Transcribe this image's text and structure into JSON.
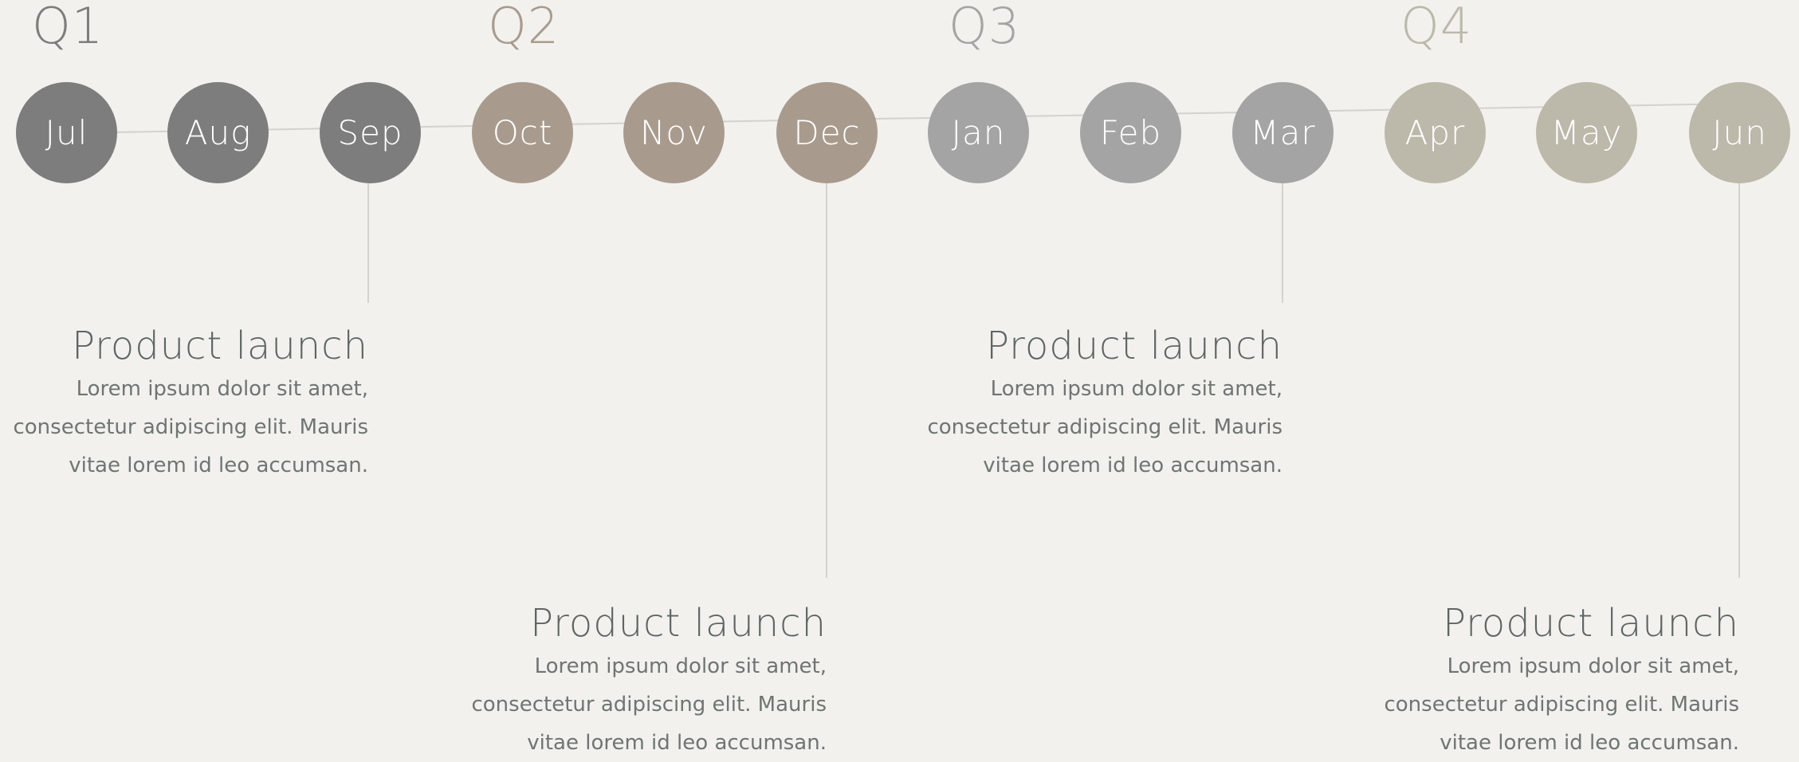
{
  "quarters": [
    {
      "label": "Q1",
      "color": "#7d7d7d"
    },
    {
      "label": "Q2",
      "color": "#a89b8e"
    },
    {
      "label": "Q3",
      "color": "#a4a4a4"
    },
    {
      "label": "Q4",
      "color": "#bcb8aa"
    }
  ],
  "months": [
    {
      "label": "Jul",
      "quarter": 0
    },
    {
      "label": "Aug",
      "quarter": 0
    },
    {
      "label": "Sep",
      "quarter": 0
    },
    {
      "label": "Oct",
      "quarter": 1
    },
    {
      "label": "Nov",
      "quarter": 1
    },
    {
      "label": "Dec",
      "quarter": 1
    },
    {
      "label": "Jan",
      "quarter": 2
    },
    {
      "label": "Feb",
      "quarter": 2
    },
    {
      "label": "Mar",
      "quarter": 2
    },
    {
      "label": "Apr",
      "quarter": 3
    },
    {
      "label": "May",
      "quarter": 3
    },
    {
      "label": "Jun",
      "quarter": 3
    }
  ],
  "milestones": [
    {
      "month": "Sep",
      "title": "Product launch",
      "body_lines": [
        "Lorem ipsum dolor sit amet,",
        "consectetur adipiscing elit. Mauris",
        "vitae lorem id leo accumsan."
      ]
    },
    {
      "month": "Dec",
      "title": "Product launch",
      "body_lines": [
        "Lorem ipsum dolor sit amet,",
        "consectetur adipiscing elit. Mauris",
        "vitae lorem id leo accumsan."
      ]
    },
    {
      "month": "Mar",
      "title": "Product launch",
      "body_lines": [
        "Lorem ipsum dolor sit amet,",
        "consectetur adipiscing elit. Mauris",
        "vitae lorem id leo accumsan."
      ]
    },
    {
      "month": "Jun",
      "title": "Product launch",
      "body_lines": [
        "Lorem ipsum dolor sit amet,",
        "consectetur adipiscing elit. Mauris",
        "vitae lorem id leo accumsan."
      ]
    }
  ],
  "colors": {
    "background": "#f2f1ed",
    "connector": "#d3d2ce",
    "title_text": "#5f6662",
    "body_text": "#6f7571"
  }
}
